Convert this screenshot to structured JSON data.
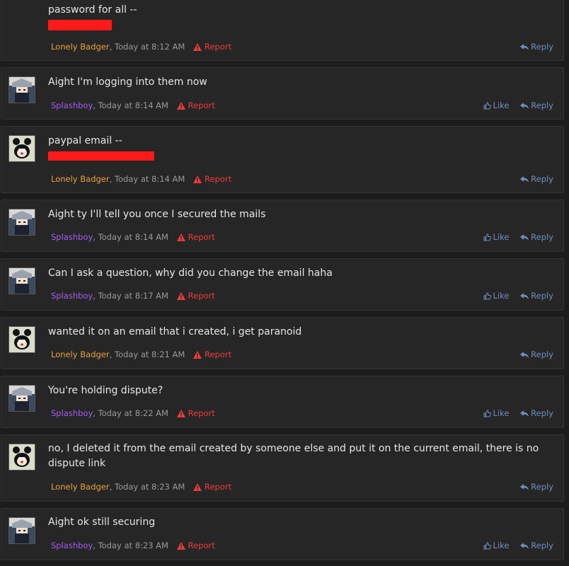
{
  "labels": {
    "report": "Report",
    "like": "Like",
    "reply": "Reply"
  },
  "posts": [
    {
      "author": "Lonely Badger",
      "time": ", Today at 8:12 AM",
      "text": "password for all --",
      "redacted": true,
      "like": false
    },
    {
      "author": "Splashboy",
      "time": ", Today at 8:14 AM",
      "text": "Aight I'm logging into them now",
      "redacted": false,
      "like": true
    },
    {
      "author": "Lonely Badger",
      "time": ", Today at 8:14 AM",
      "text": "paypal email --",
      "redacted": true,
      "like": false
    },
    {
      "author": "Splashboy",
      "time": ", Today at 8:14 AM",
      "text": "Aight ty I'll tell you once I secured the mails",
      "redacted": false,
      "like": true
    },
    {
      "author": "Splashboy",
      "time": ", Today at 8:17 AM",
      "text": "Can I ask a question, why did you change the email haha",
      "redacted": false,
      "like": true
    },
    {
      "author": "Lonely Badger",
      "time": ", Today at 8:21 AM",
      "text": "wanted it on an email that i created, i get paranoid",
      "redacted": false,
      "like": false
    },
    {
      "author": "Splashboy",
      "time": ", Today at 8:22 AM",
      "text": "You're holding dispute?",
      "redacted": false,
      "like": true
    },
    {
      "author": "Lonely Badger",
      "time": ", Today at 8:23 AM",
      "text": "no, I deleted it from the email created by someone else and put it on the current email, there is no dispute link",
      "redacted": false,
      "like": false
    },
    {
      "author": "Splashboy",
      "time": ", Today at 8:23 AM",
      "text": "Aight ok still securing",
      "redacted": false,
      "like": true
    }
  ]
}
